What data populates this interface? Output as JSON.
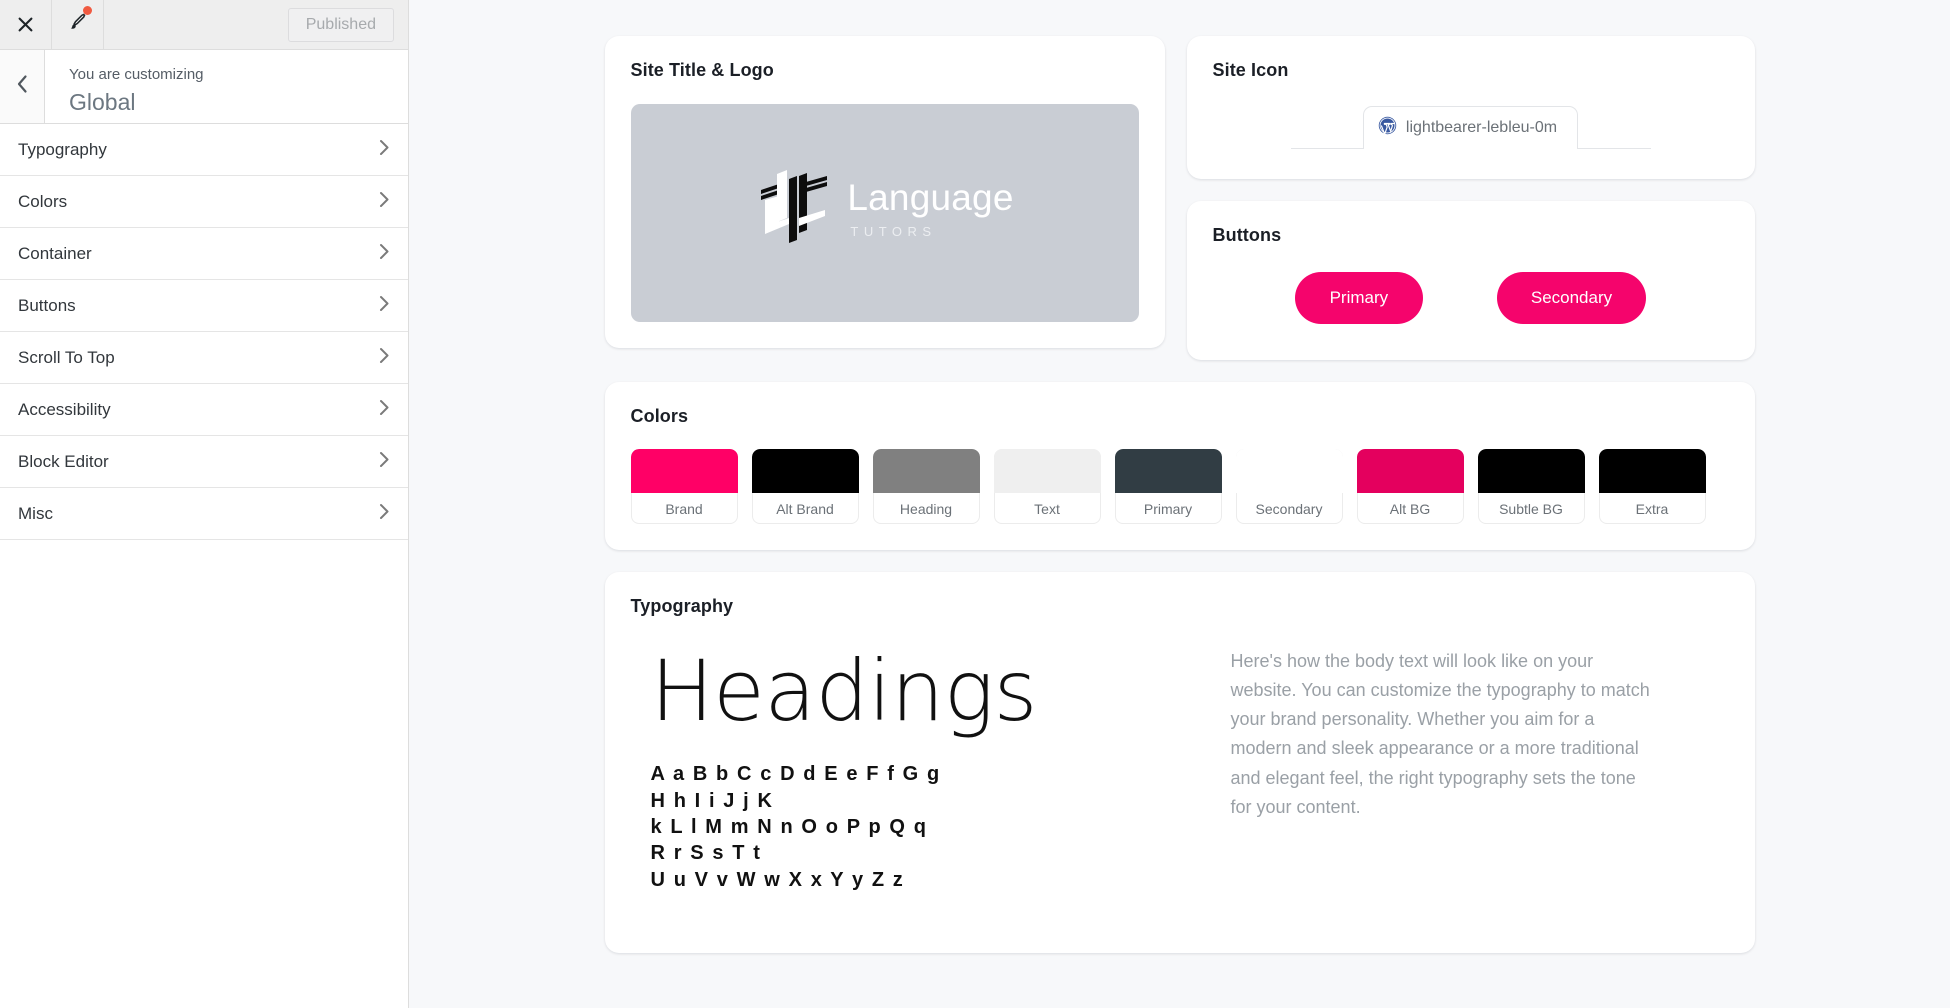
{
  "customizer": {
    "topbar": {
      "close_icon": "close-icon",
      "brush_icon": "brush-icon",
      "published_label": "Published"
    },
    "header": {
      "back_icon": "chevron-left-icon",
      "kicker": "You are customizing",
      "title": "Global"
    },
    "menu_items": [
      {
        "label": "Typography"
      },
      {
        "label": "Colors"
      },
      {
        "label": "Container"
      },
      {
        "label": "Buttons"
      },
      {
        "label": "Scroll To Top"
      },
      {
        "label": "Accessibility"
      },
      {
        "label": "Block Editor"
      },
      {
        "label": "Misc"
      }
    ]
  },
  "preview": {
    "site_logo_card": {
      "title": "Site Title & Logo",
      "logo_word": "Language",
      "logo_sub": "TUTORS",
      "placeholder_color": "#c9cdd4"
    },
    "site_icon_card": {
      "title": "Site Icon",
      "tab_label": "lightbearer-lebleu-0m",
      "favicon": "wordpress-icon"
    },
    "buttons_card": {
      "title": "Buttons",
      "primary_label": "Primary",
      "secondary_label": "Secondary",
      "primary_color": "#f5046c",
      "secondary_color": "#f5046c"
    },
    "colors_card": {
      "title": "Colors",
      "swatches": [
        {
          "label": "Brand",
          "color": "#ff0066"
        },
        {
          "label": "Alt Brand",
          "color": "#000000"
        },
        {
          "label": "Heading",
          "color": "#808080"
        },
        {
          "label": "Text",
          "color": "#efefef"
        },
        {
          "label": "Primary",
          "color": "#313d44"
        },
        {
          "label": "Secondary",
          "color": "#ffffff"
        },
        {
          "label": "Alt BG",
          "color": "#e4005e"
        },
        {
          "label": "Subtle BG",
          "color": "#000000"
        },
        {
          "label": "Extra",
          "color": "#000000"
        }
      ]
    },
    "typography_card": {
      "title": "Typography",
      "heading_sample": "Headings",
      "alphabet_line1": "A a B b C c D d E e F f G g H h I i J j K",
      "alphabet_line2": "k L l M m N n O o P p Q q R r S s T t",
      "alphabet_line3": "U u V v W w X x Y y Z z",
      "body_text": "Here's how the body text will look like on your website. You can customize the typography to match your brand personality. Whether you aim for a modern and sleek appearance or a more traditional and elegant feel, the right typography sets the tone for your content."
    }
  }
}
